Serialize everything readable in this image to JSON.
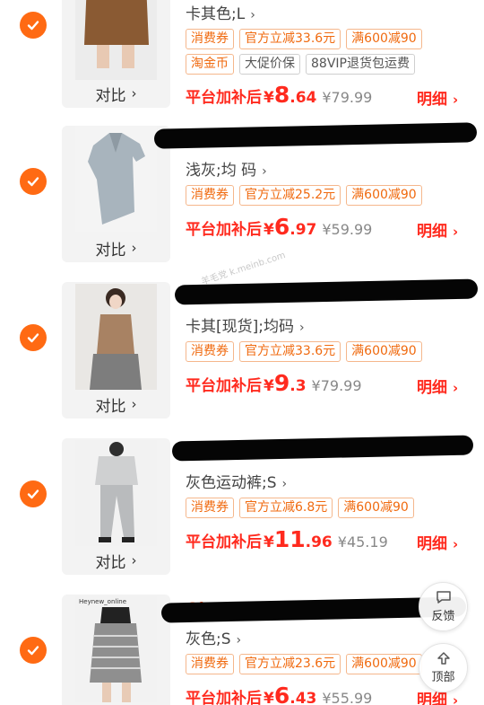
{
  "common": {
    "compare_label": "对比",
    "detail_label": "明细",
    "price_prefix": "平台加补后",
    "currency": "¥"
  },
  "items": [
    {
      "variant": "卡其色;L",
      "tags": [
        {
          "text": "消费券",
          "style": "orange"
        },
        {
          "text": "官方立减33.6元",
          "style": "orange"
        },
        {
          "text": "满600减90",
          "style": "orange"
        }
      ],
      "extra_tags": [
        {
          "text": "淘金币",
          "style": "orange"
        },
        {
          "text": "大促价保",
          "style": "grey"
        },
        {
          "text": "88VIP退货包运费",
          "style": "grey"
        }
      ],
      "price_int": "8",
      "price_dec": ".64",
      "original_price": "¥79.99"
    },
    {
      "variant": "浅灰;均 码",
      "tags": [
        {
          "text": "消费券",
          "style": "orange"
        },
        {
          "text": "官方立减25.2元",
          "style": "orange"
        },
        {
          "text": "满600减90",
          "style": "orange"
        }
      ],
      "price_int": "6",
      "price_dec": ".97",
      "original_price": "¥59.99"
    },
    {
      "variant": "卡其[现货];均码",
      "tags": [
        {
          "text": "消费券",
          "style": "orange"
        },
        {
          "text": "官方立减33.6元",
          "style": "orange"
        },
        {
          "text": "满600减90",
          "style": "orange"
        }
      ],
      "price_int": "9",
      "price_dec": ".3",
      "original_price": "¥79.99"
    },
    {
      "variant": "灰色运动裤;S",
      "tags": [
        {
          "text": "消费券",
          "style": "orange"
        },
        {
          "text": "官方立减6.8元",
          "style": "orange"
        },
        {
          "text": "满600减90",
          "style": "orange"
        }
      ],
      "price_int": "11",
      "price_dec": ".96",
      "original_price": "¥45.19"
    },
    {
      "variant": "灰色;S",
      "tags": [
        {
          "text": "消费券",
          "style": "orange"
        },
        {
          "text": "官方立减23.6元",
          "style": "orange"
        },
        {
          "text": "满600减90",
          "style": "orange"
        }
      ],
      "price_int": "6",
      "price_dec": ".43",
      "original_price": "¥55.99"
    }
  ],
  "floating": {
    "feedback_label": "反馈",
    "top_label": "顶部"
  },
  "watermark": "羊毛党 k.meinb.com",
  "image_texts": {
    "item5_brand": "Heynew_online",
    "item5_title_fragment": "Ola"
  },
  "colors": {
    "accent": "#ff6a13",
    "price_red": "#ff2a1e"
  }
}
